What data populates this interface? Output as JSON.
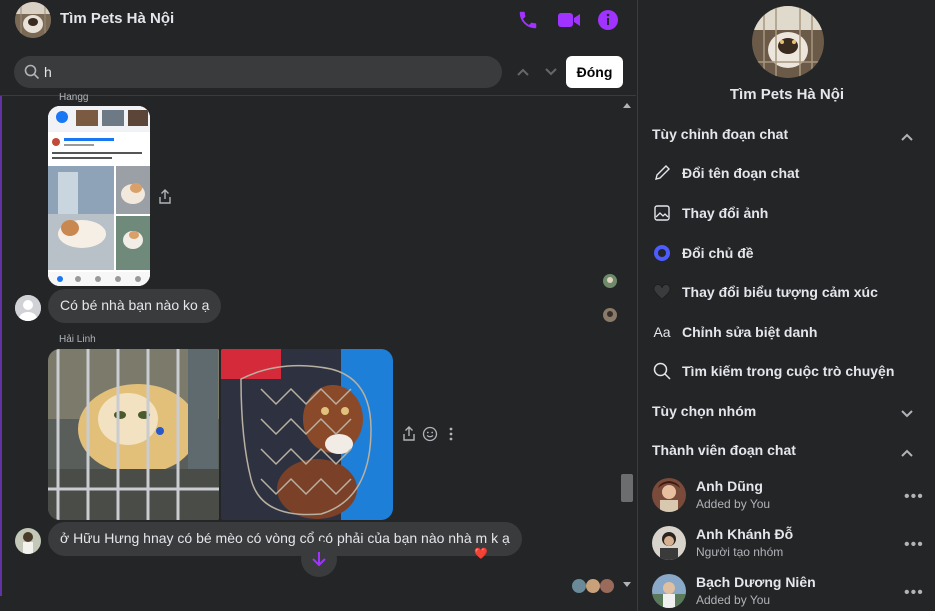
{
  "header": {
    "title": "Tìm Pets Hà Nội"
  },
  "search": {
    "query": "h",
    "close_label": "Đóng"
  },
  "messages": {
    "m1_sender": "Hangg",
    "m2_text": "Có bé nhà bạn nào ko ạ",
    "m3_sender": "Hải Linh",
    "m4_text": "ở Hữu Hưng hnay có bé mèo có vòng cổ có phải của bạn nào nhà m k ạ",
    "screenshot_header": "TÌM MÈO CHÓ LẠC VÀ HỖ ĐÓNG THÚ CƯNG",
    "reaction": "❤️"
  },
  "panel": {
    "title": "Tìm Pets Hà Nội",
    "customize_label": "Tùy chỉnh đoạn chat",
    "options": [
      {
        "label": "Đổi tên đoạn chat",
        "icon": "pencil-icon"
      },
      {
        "label": "Thay đổi ảnh",
        "icon": "image-icon"
      },
      {
        "label": "Đổi chủ đề",
        "icon": "theme-icon"
      },
      {
        "label": "Thay đổi biểu tượng cảm xúc",
        "icon": "heart-icon"
      },
      {
        "label": "Chỉnh sửa biệt danh",
        "icon": "nickname-icon"
      },
      {
        "label": "Tìm kiếm trong cuộc trò chuyện",
        "icon": "search-icon"
      }
    ],
    "group_options_label": "Tùy chọn nhóm",
    "members_label": "Thành viên đoạn chat",
    "members": [
      {
        "name": "Anh Dũng",
        "sub": "Added by You"
      },
      {
        "name": "Anh Khánh Đỗ",
        "sub": "Người tạo nhóm"
      },
      {
        "name": "Bạch Dương Niên",
        "sub": "Added by You"
      }
    ]
  },
  "colors": {
    "accent": "#a033ff",
    "bg": "#242526",
    "bubble": "#3a3b3c",
    "theme": "#4d5cff"
  }
}
